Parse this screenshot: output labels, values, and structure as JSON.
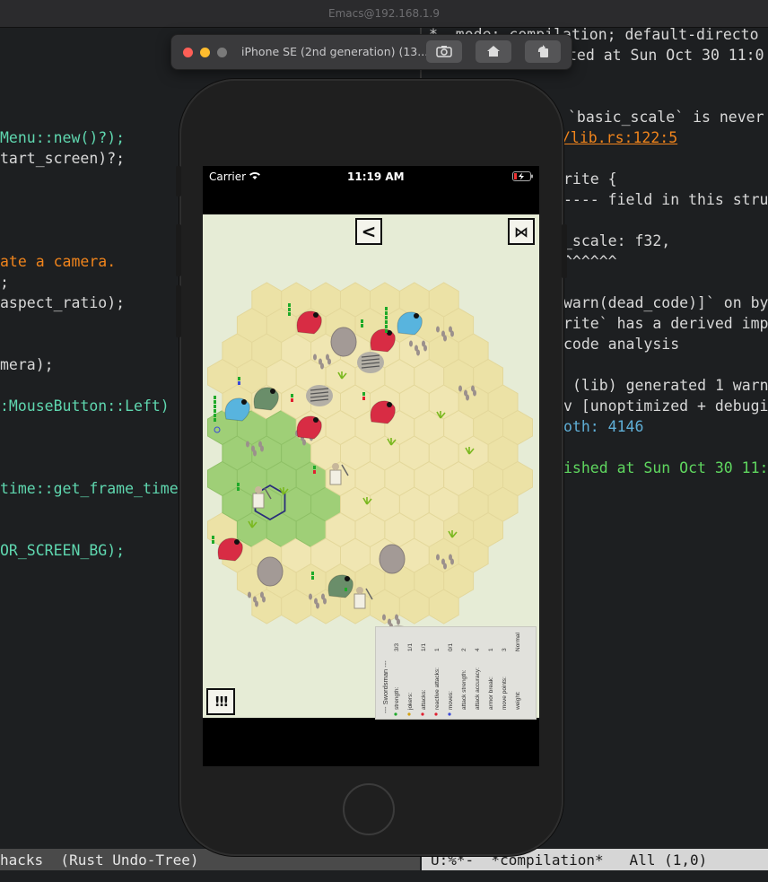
{
  "window": {
    "title": "Emacs@192.168.1.9"
  },
  "editor_left": {
    "lines": [
      {
        "text": "Menu::new()?);",
        "color": "#5fd7af"
      },
      {
        "text": "tart_screen)?;",
        "color": "#d8d8d8"
      },
      {
        "text": "ate a camera.",
        "color": "#f0841c"
      },
      {
        "text": ";",
        "color": "#d8d8d8"
      },
      {
        "text": "aspect_ratio);",
        "color": "#d8d8d8"
      },
      {
        "text": "mera);",
        "color": "#d8d8d8"
      },
      {
        "text": ":MouseButton::Left)",
        "color": "#5fd7af"
      },
      {
        "text": "time::get_frame_time",
        "color": "#5fd7af"
      },
      {
        "text": "OR_SCREEN_BG);",
        "color": "#5fd7af"
      }
    ]
  },
  "editor_right": {
    "lines": [
      {
        "text": "*- mode: compilation; default-directo",
        "color": "#d8d8d8"
      },
      {
        "text": "ted at Sun Oct 30 11:0",
        "color": "#d8d8d8"
      },
      {
        "text": "`basic_scale` is never",
        "color": "#d8d8d8"
      },
      {
        "text": "/lib.rs:122:5",
        "color": "#f0841c"
      },
      {
        "text": "rite {",
        "color": "#d8d8d8"
      },
      {
        "text": "---- field in this stru",
        "color": "#d8d8d8"
      },
      {
        "text": "_scale: f32,",
        "color": "#d8d8d8"
      },
      {
        "text": "^^^^^^",
        "color": "#d8d8d8"
      },
      {
        "text": "warn(dead_code)]` on by",
        "color": "#d8d8d8"
      },
      {
        "text": "rite` has a derived imp",
        "color": "#d8d8d8"
      },
      {
        "text": "code analysis",
        "color": "#d8d8d8"
      },
      {
        "text": "(lib) generated 1 warn",
        "color": "#d8d8d8"
      },
      {
        "text": "v [unoptimized + debugi",
        "color": "#d8d8d8"
      },
      {
        "text": "oth: 4146",
        "color": "#5fafd7"
      },
      {
        "text": "ished at Sun Oct 30 11:",
        "color": "#5fd75f"
      }
    ]
  },
  "modeline_left": {
    "text": "hacks  (Rust Undo-Tree)"
  },
  "modeline_right": {
    "text": "U:%*-  *compilation*   All (1,0)"
  },
  "simulator": {
    "title": "iPhone SE (2nd generation) (13...",
    "buttons": [
      "screenshot-icon",
      "home-icon",
      "rotate-icon"
    ]
  },
  "phone": {
    "carrier": "Carrier",
    "time": "11:19 AM"
  },
  "game": {
    "back_label": "<",
    "end_turn_label": "⋈",
    "menu_label": "!!!",
    "unit_info": {
      "title": "--- Swordsman ---",
      "rows": [
        {
          "label": "strength:",
          "value": "3/3"
        },
        {
          "label": "jokers:",
          "value": "1/1"
        },
        {
          "label": "attacks:",
          "value": "1/1"
        },
        {
          "label": "reactive attacks:",
          "value": "1"
        },
        {
          "label": "moves:",
          "value": "0/1"
        },
        {
          "label": "attack strength:",
          "value": "2"
        },
        {
          "label": "attack accuracy:",
          "value": "4"
        },
        {
          "label": "armor break:",
          "value": "1"
        },
        {
          "label": "move points:",
          "value": "3"
        },
        {
          "label": "weight:",
          "value": "Normal"
        }
      ]
    }
  }
}
